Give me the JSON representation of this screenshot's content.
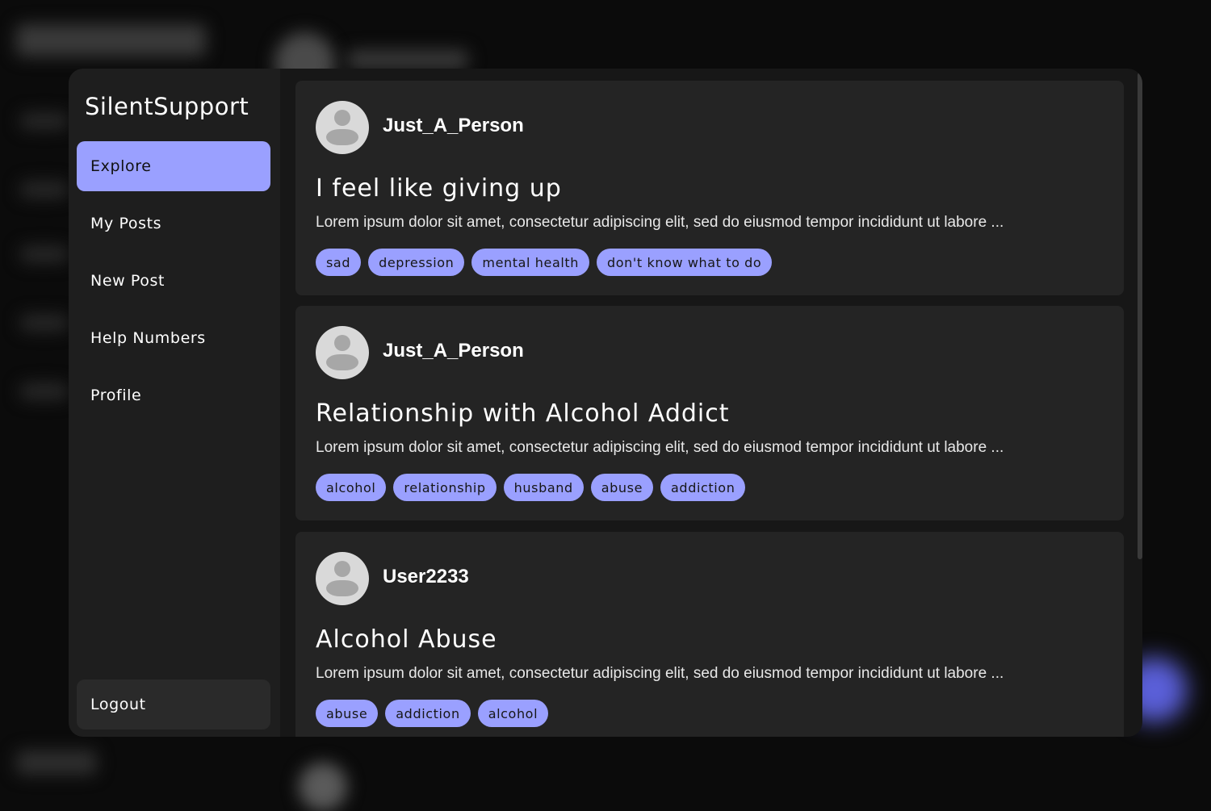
{
  "app": {
    "name": "SilentSupport"
  },
  "nav": {
    "items": [
      {
        "label": "Explore"
      },
      {
        "label": "My Posts"
      },
      {
        "label": "New Post"
      },
      {
        "label": "Help Numbers"
      },
      {
        "label": "Profile"
      }
    ],
    "active": "Explore",
    "logout_label": "Logout"
  },
  "posts": [
    {
      "username": "Just_A_Person",
      "title": "I feel like giving up",
      "excerpt": "Lorem ipsum dolor sit amet, consectetur adipiscing elit, sed do eiusmod tempor incididunt ut labore ...",
      "tags": [
        "sad",
        "depression",
        "mental health",
        "don't know what to do"
      ]
    },
    {
      "username": "Just_A_Person",
      "title": "Relationship with Alcohol Addict",
      "excerpt": "Lorem ipsum dolor sit amet, consectetur adipiscing elit, sed do eiusmod tempor incididunt ut labore ...",
      "tags": [
        "alcohol",
        "relationship",
        "husband",
        "abuse",
        "addiction"
      ]
    },
    {
      "username": "User2233",
      "title": "Alcohol Abuse",
      "excerpt": "Lorem ipsum dolor sit amet, consectetur adipiscing elit, sed do eiusmod tempor incididunt ut labore ...",
      "tags": [
        "abuse",
        "addiction",
        "alcohol"
      ]
    }
  ],
  "colors": {
    "accent": "#9aa0ff",
    "sidebar": "#1e1e1e",
    "card": "#242424",
    "background": "#171717"
  }
}
